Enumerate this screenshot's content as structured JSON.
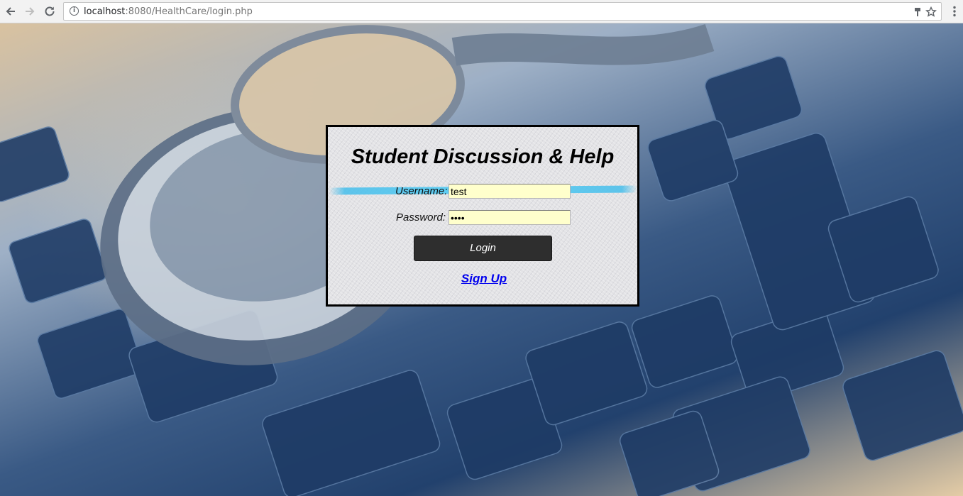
{
  "browser": {
    "url_host": "localhost",
    "url_path": ":8080/HealthCare/login.php"
  },
  "login": {
    "title": "Student Discussion & Help",
    "username_label": "Username:",
    "username_value": "test",
    "password_label": "Password:",
    "password_value": "test",
    "login_button": "Login",
    "signup_link": "Sign Up"
  },
  "colors": {
    "input_background": "#ffffcc",
    "button_background": "#2e2e2e",
    "link": "#0000ee",
    "panel_border": "#000000"
  }
}
